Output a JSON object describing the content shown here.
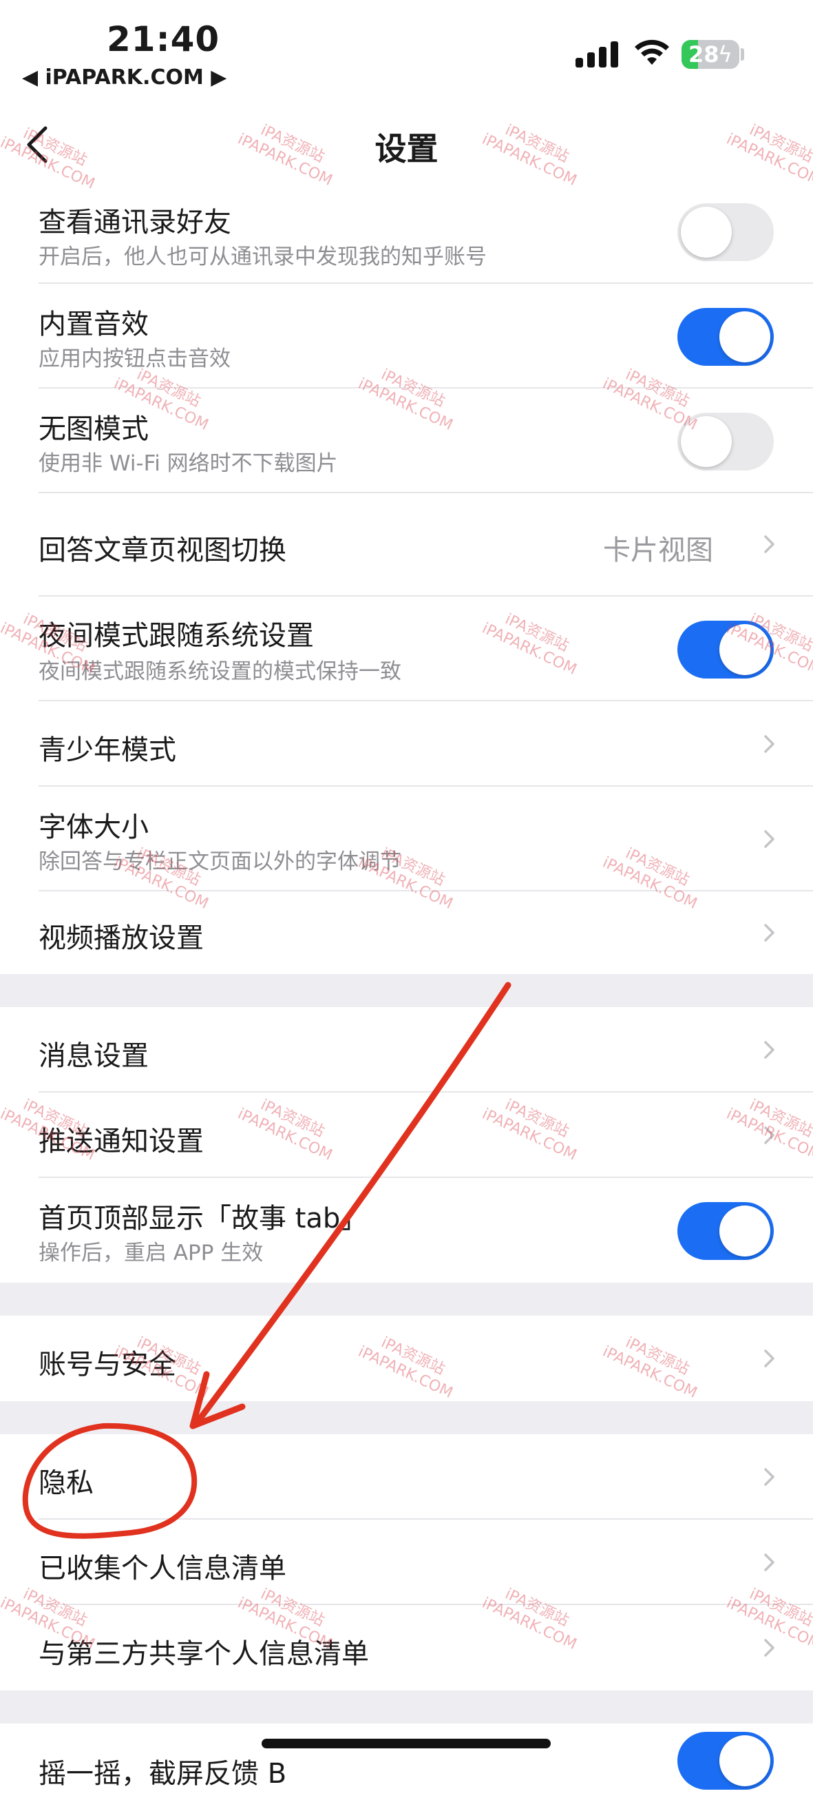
{
  "status_bar": {
    "time": "21:40",
    "carrier": "◀ iPAPARK.COM ▶",
    "battery_level": "28",
    "battery_percent": 28
  },
  "nav": {
    "title": "设置",
    "back_icon": "chevron-left-icon"
  },
  "rows": [
    {
      "title": "查看通讯录好友",
      "subtitle": "开启后，他人也可从通讯录中发现我的知乎账号",
      "toggle": false
    },
    {
      "title": "内置音效",
      "subtitle": "应用内按钮点击音效",
      "toggle": true
    },
    {
      "title": "无图模式",
      "subtitle": "使用非 Wi-Fi 网络时不下载图片",
      "toggle": false
    },
    {
      "title": "回答文章页视图切换",
      "value": "卡片视图"
    },
    {
      "title": "夜间模式跟随系统设置",
      "subtitle": "夜间模式跟随系统设置的模式保持一致",
      "toggle": true
    },
    {
      "title": "青少年模式"
    },
    {
      "title": "字体大小",
      "subtitle": "除回答与专栏正文页面以外的字体调节"
    },
    {
      "title": "视频播放设置"
    },
    {
      "title": "消息设置"
    },
    {
      "title": "推送通知设置"
    },
    {
      "title": "首页顶部显示「故事 tab」",
      "subtitle": "操作后，重启 APP 生效",
      "toggle": true
    },
    {
      "title": "账号与安全"
    },
    {
      "title": "隐私"
    },
    {
      "title": "已收集个人信息清单"
    },
    {
      "title": "与第三方共享个人信息清单"
    },
    {
      "title": "摇一摇，截屏反馈 B",
      "toggle": true
    }
  ],
  "watermark": {
    "line1": "iPA资源站",
    "line2": "iPAPARK.COM"
  },
  "colors": {
    "toggle_on": "#1b6ef3",
    "toggle_off": "#e9e9eb",
    "annotation": "#e0321f",
    "section_gap": "#eeeef2"
  }
}
